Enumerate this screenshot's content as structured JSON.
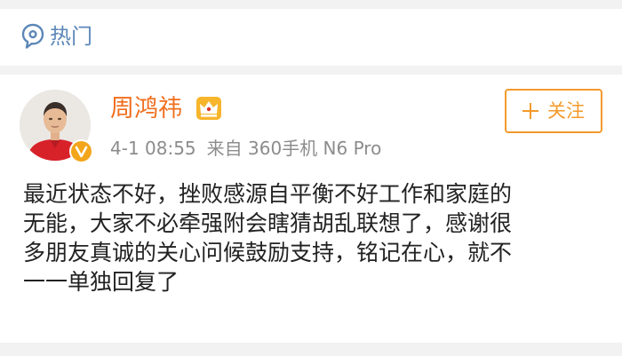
{
  "header": {
    "section_label": "热门",
    "icon": "hot-topic-speech-icon",
    "color": "#5c87b8"
  },
  "post": {
    "author": {
      "name": "周鸿祎",
      "name_color": "#f06e1e",
      "avatar": "avatar-man-red-shirt",
      "badges": [
        "verified-v-badge-icon",
        "crown-icon"
      ]
    },
    "date": "4-1 08:55",
    "source": "来自 360手机 N6 Pro",
    "follow_button": {
      "label": "关注",
      "icon": "plus-icon",
      "color": "#f39a2b"
    },
    "text_lines": [
      "最近状态不好，挫败感源自平衡不好工作和家庭的",
      "无能，大家不必牵强附会瞎猜胡乱联想了，感谢很",
      "多朋友真诚的关心问候鼓励支持，铭记在心，就不",
      "一一单独回复了"
    ]
  }
}
